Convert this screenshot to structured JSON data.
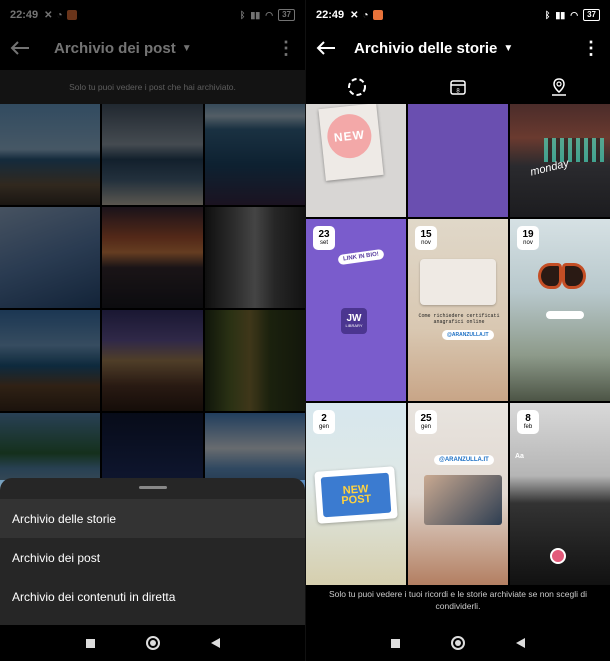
{
  "status": {
    "time": "22:49",
    "battery": "37"
  },
  "left": {
    "title": "Archivio dei post",
    "info": "Solo tu puoi vedere i post che hai archiviato.",
    "sheet": {
      "items": [
        {
          "label": "Archivio delle storie"
        },
        {
          "label": "Archivio dei post"
        },
        {
          "label": "Archivio dei contenuti in diretta"
        }
      ]
    }
  },
  "right": {
    "title": "Archivio delle storie",
    "stories": [
      {
        "day": "",
        "month": "",
        "text": "NEW"
      },
      {
        "day": "",
        "month": "",
        "text": ""
      },
      {
        "day": "",
        "month": "",
        "text": "monday"
      },
      {
        "day": "23",
        "month": "set",
        "text": "LINK IN BIO!",
        "text2": "JW",
        "text3": "LIBRARY"
      },
      {
        "day": "15",
        "month": "nov",
        "text": "Come richiedere certificati anagrafici online",
        "text2": "@ARANZULLA.IT"
      },
      {
        "day": "19",
        "month": "nov",
        "text": ""
      },
      {
        "day": "2",
        "month": "gen",
        "text": "NEW POST"
      },
      {
        "day": "25",
        "month": "gen",
        "text": "@ARANZULLA.IT"
      },
      {
        "day": "8",
        "month": "feb",
        "text": "Aa"
      }
    ],
    "footer": "Solo tu puoi vedere i tuoi ricordi e le storie archiviate se non scegli di condividerli."
  }
}
